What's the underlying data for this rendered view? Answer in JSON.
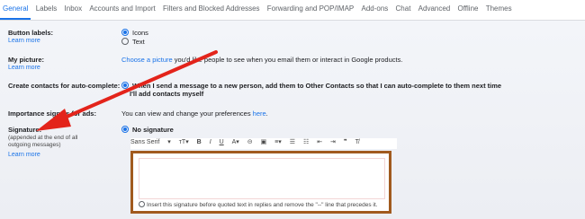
{
  "tabs": [
    "General",
    "Labels",
    "Inbox",
    "Accounts and Import",
    "Filters and Blocked Addresses",
    "Forwarding and POP/IMAP",
    "Add-ons",
    "Chat",
    "Advanced",
    "Offline",
    "Themes"
  ],
  "button_labels": {
    "label": "Button labels:",
    "learn_more": "Learn more",
    "options": [
      "Icons",
      "Text"
    ]
  },
  "my_picture": {
    "label": "My picture:",
    "learn_more": "Learn more",
    "link": "Choose a picture",
    "text": " you'd like people to see when you email them or interact in Google products."
  },
  "contacts": {
    "label": "Create contacts for auto-complete:",
    "opt1": "When I send a message to a new person, add them to Other Contacts so that I can auto-complete to them next time",
    "opt2": "I'll add contacts myself"
  },
  "importance": {
    "label": "Importance signals for ads:",
    "text": "You can view and change your preferences ",
    "link": "here",
    "end": "."
  },
  "signature": {
    "label": "Signature:",
    "sub": "(appended at the end of all outgoing messages)",
    "learn_more": "Learn more",
    "no_signature": "No signature",
    "font": "Sans Serif",
    "hint": "Insert this signature before quoted text in replies and remove the \"--\" line that precedes it."
  },
  "colors": {
    "accent": "#1a73e8",
    "arrow": "#e3241b",
    "highlight_border": "#a15a1e"
  }
}
